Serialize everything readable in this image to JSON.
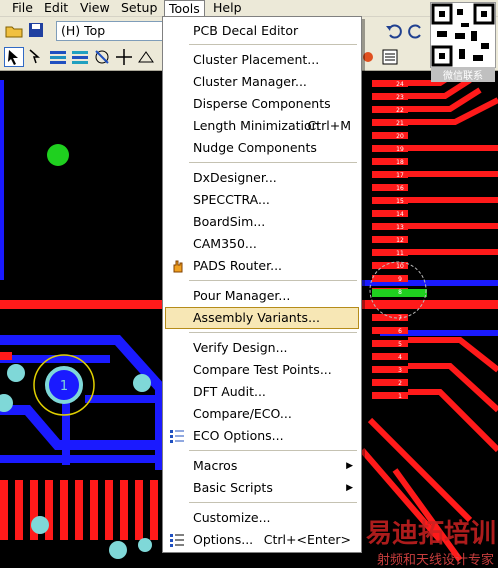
{
  "menubar": {
    "items": [
      {
        "label": "File"
      },
      {
        "label": "Edit"
      },
      {
        "label": "View"
      },
      {
        "label": "Setup"
      },
      {
        "label": "Tools"
      },
      {
        "label": "Help"
      }
    ]
  },
  "toolbar": {
    "layer_value": "(H) Top"
  },
  "tools_menu": {
    "items": [
      {
        "label": "PCB Decal Editor"
      },
      {
        "label": "Cluster Placement..."
      },
      {
        "label": "Cluster Manager..."
      },
      {
        "label": "Disperse Components"
      },
      {
        "label": "Length Minimization",
        "shortcut": "Ctrl+M"
      },
      {
        "label": "Nudge Components"
      },
      {
        "label": "DxDesigner..."
      },
      {
        "label": "SPECCTRA..."
      },
      {
        "label": "BoardSim..."
      },
      {
        "label": "CAM350..."
      },
      {
        "label": "PADS Router..."
      },
      {
        "label": "Pour Manager..."
      },
      {
        "label": "Assembly Variants...",
        "highlighted": true
      },
      {
        "label": "Verify Design..."
      },
      {
        "label": "Compare Test Points..."
      },
      {
        "label": "DFT Audit..."
      },
      {
        "label": "Compare/ECO..."
      },
      {
        "label": "ECO Options..."
      },
      {
        "label": "Macros"
      },
      {
        "label": "Basic Scripts"
      },
      {
        "label": "Customize..."
      },
      {
        "label": "Options...",
        "shortcut": "Ctrl+<Enter>"
      }
    ]
  },
  "pcb": {
    "pad_label": "1",
    "pin_numbers": [
      "24",
      "23",
      "22",
      "21",
      "20",
      "19",
      "18",
      "17",
      "16",
      "15",
      "14",
      "13",
      "12",
      "11",
      "10",
      "9",
      "8",
      "7",
      "6",
      "5",
      "4",
      "3",
      "2",
      "1"
    ]
  },
  "watermark": {
    "main": "易迪拓培训",
    "sub": "射频和天线设计专家",
    "corner": "微信联系"
  },
  "colors": {
    "trace_red": "#ff1a1a",
    "trace_blue": "#1a1aff",
    "pad_cyan": "#7fd8d8",
    "green": "#1fd01f",
    "menu_highlight": "#f7e7b5"
  }
}
